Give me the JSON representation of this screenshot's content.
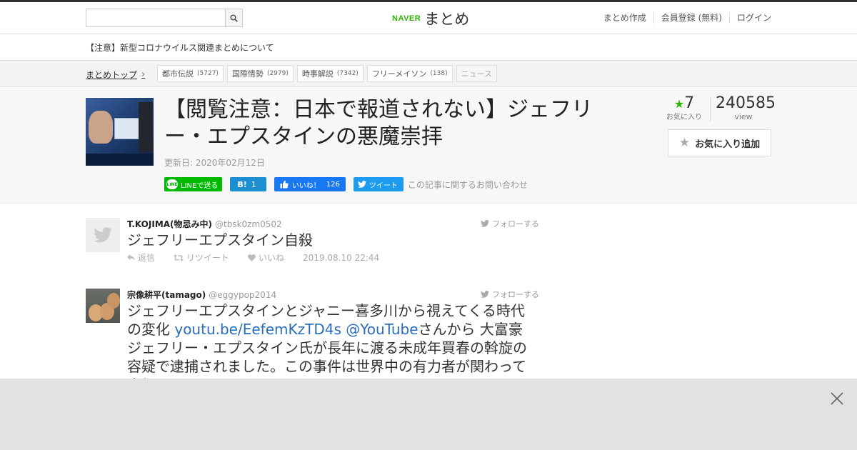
{
  "header": {
    "search": {
      "placeholder": ""
    },
    "logo": {
      "naver": "NAVER",
      "matome": "まとめ"
    },
    "nav": [
      "まとめ作成",
      "会員登録 (無料)",
      "ログイン"
    ]
  },
  "notice": {
    "text": "【注意】新型コロナウイルス関連まとめについて"
  },
  "categories": {
    "breadcrumb": "まとめトップ",
    "tags": [
      {
        "label": "都市伝説",
        "count": "(5727)"
      },
      {
        "label": "国際情勢",
        "count": "(2979)"
      },
      {
        "label": "時事解説",
        "count": "(7342)"
      },
      {
        "label": "フリーメイソン",
        "count": "(138)"
      },
      {
        "label": "ニュース",
        "count": ""
      }
    ]
  },
  "article": {
    "title": "【閲覧注意：日本で報道されない】ジェフリー・エプスタインの悪魔崇拝",
    "updated": "更新日: 2020年02月12日",
    "share": {
      "line": "LINEで送る",
      "hatena_label": "B!",
      "hatena_count": "1",
      "fb_label": "いいね！",
      "fb_count": "126",
      "tweet": "ツイート",
      "inquiry": "この記事に関するお問い合わせ"
    },
    "stats": {
      "favorites": "7",
      "favorites_label": "お気に入り",
      "views": "240585",
      "views_label": "view"
    },
    "fav_button": "お気に入り追加"
  },
  "tweets": [
    {
      "name": "T.KOJIMA(物忌み中)",
      "handle": "@tbsk0zm0502",
      "follow": "フォローする",
      "text": "ジェフリーエプスタイン自殺",
      "actions": {
        "reply": "返信",
        "retweet": "リツイート",
        "like": "いいね"
      },
      "date": "2019.08.10 22:44"
    },
    {
      "name": "宗像耕平(tamago)",
      "handle": "@eggypop2014",
      "follow": "フォローする",
      "text_a": "ジェフリーエプスタインとジャニー喜多川から視えてくる時代の変化 ",
      "link1": "youtu.be/EefemKzTD4s",
      "link2": " @YouTube",
      "text_b": "さんから 大富豪ジェフリー・エプスタイン氏が長年に渡る未成年買春の斡旋の容疑で逮捕されました。この事件は世界中の有力者が関わって人類"
    }
  ],
  "colors": {
    "naver_green": "#2db400",
    "line_green": "#00b900",
    "hatena_blue": "#1b8fd2",
    "fb_blue": "#1877f2",
    "twitter_blue": "#1d9bf0",
    "link_blue": "#2a6ebb"
  }
}
